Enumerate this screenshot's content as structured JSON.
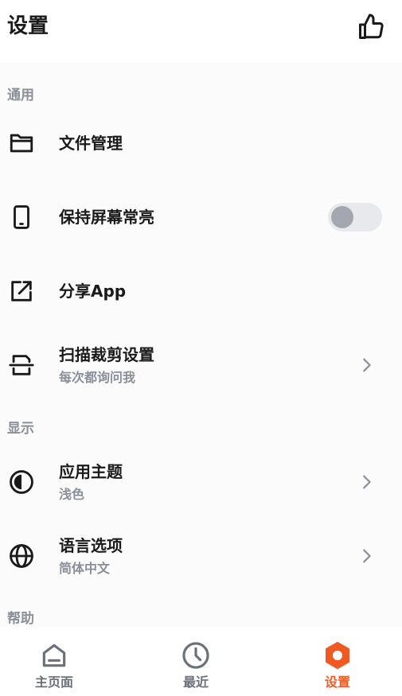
{
  "header": {
    "title": "设置",
    "like_icon": "thumbs-up-icon"
  },
  "sections": {
    "general": {
      "title": "通用",
      "file_manage": {
        "label": "文件管理",
        "icon": "folder-icon"
      },
      "keep_screen_on": {
        "label": "保持屏幕常亮",
        "icon": "phone-icon",
        "toggle_on": false
      },
      "share_app": {
        "label": "分享App",
        "icon": "share-external-icon"
      },
      "scan_crop": {
        "label": "扫描裁剪设置",
        "sub": "每次都询问我",
        "icon": "scan-crop-icon"
      }
    },
    "display": {
      "title": "显示",
      "theme": {
        "label": "应用主题",
        "sub": "浅色",
        "icon": "theme-contrast-icon"
      },
      "language": {
        "label": "语言选项",
        "sub": "简体中文",
        "icon": "globe-icon"
      }
    },
    "help": {
      "title": "帮助"
    }
  },
  "bottom_nav": [
    {
      "label": "主页面",
      "icon": "home-icon",
      "active": false
    },
    {
      "label": "最近",
      "icon": "clock-icon",
      "active": false
    },
    {
      "label": "设置",
      "icon": "settings-hexagon-icon",
      "active": true
    }
  ],
  "colors": {
    "accent": "#f05a22",
    "text": "#1a1a1a",
    "muted": "#8a8f99",
    "toggle_track": "#e7e9ec",
    "toggle_knob": "#a3a8b0"
  }
}
